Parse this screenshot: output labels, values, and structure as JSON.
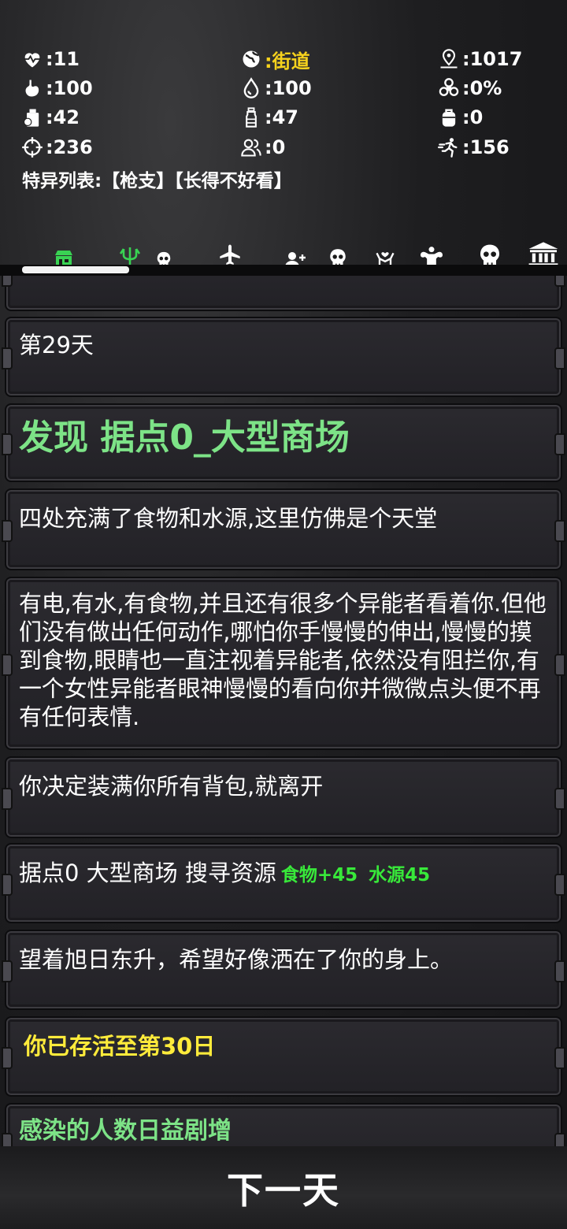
{
  "stats": {
    "col1": [
      {
        "icon": "heart-pulse-icon",
        "value": ":11"
      },
      {
        "icon": "stomach-icon",
        "value": ":100"
      },
      {
        "icon": "food-bag-icon",
        "value": ":42"
      },
      {
        "icon": "crosshair-icon",
        "value": ":236"
      }
    ],
    "col2": [
      {
        "icon": "globe-icon",
        "value": ":街道",
        "highlight": "#f6d21d"
      },
      {
        "icon": "water-drop-icon",
        "value": ":100"
      },
      {
        "icon": "bottle-icon",
        "value": ":47"
      },
      {
        "icon": "people-icon",
        "value": ":0"
      }
    ],
    "col3": [
      {
        "icon": "location-pin-icon",
        "value": ":1017"
      },
      {
        "icon": "biohazard-icon",
        "value": ":0%"
      },
      {
        "icon": "backpack-icon",
        "value": ":0"
      },
      {
        "icon": "running-man-icon",
        "value": ":156"
      }
    ],
    "traits": "特异列表:【枪支】【长得不好看】"
  },
  "tabs": [
    {
      "icon": "shop-icon",
      "color": "#39d353"
    },
    {
      "icon": "trident-icon",
      "color": "#39d353"
    },
    {
      "icon": "skull-icon",
      "color": "#ffffff"
    },
    {
      "icon": "airplane-icon",
      "color": "#ffffff"
    },
    {
      "icon": "add-person-icon",
      "color": "#ffffff"
    },
    {
      "icon": "skull-icon",
      "color": "#ffffff"
    },
    {
      "icon": "hand-heart-icon",
      "color": "#ffffff"
    },
    {
      "icon": "muscle-icon",
      "color": "#ffffff"
    },
    {
      "icon": "skull-icon",
      "color": "#ffffff"
    },
    {
      "icon": "bank-icon",
      "color": "#ffffff"
    }
  ],
  "log": {
    "day": "第29天",
    "discover": "发现 据点0_大型商场",
    "line1": "四处充满了食物和水源,这里仿佛是个天堂",
    "line2": "有电,有水,有食物,并且还有很多个异能者看着你.但他们没有做出任何动作,哪怕你手慢慢的伸出,慢慢的摸到食物,眼睛也一直注视着异能者,依然没有阻拦你,有一个女性异能者眼神慢慢的看向你并微微点头便不再有任何表情.",
    "line3": "你决定装满你所有背包,就离开",
    "search": "据点0 大型商场 搜寻资源",
    "food_gain": "食物+45",
    "water_gain": "水源45",
    "line4": "望着旭日东升，希望好像洒在了你的身上。",
    "survived": "你已存活至第30日",
    "infection": "感染的人数日益剧增"
  },
  "bottom": {
    "next_label": "下一天"
  }
}
